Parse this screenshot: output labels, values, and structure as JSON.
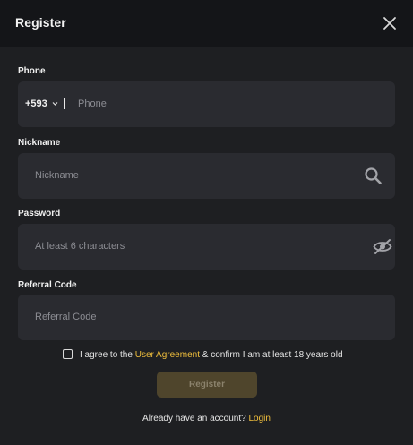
{
  "header": {
    "title": "Register"
  },
  "phone": {
    "label": "Phone",
    "country_code": "+593",
    "placeholder": "Phone"
  },
  "nickname": {
    "label": "Nickname",
    "placeholder": "Nickname"
  },
  "password": {
    "label": "Password",
    "placeholder": "At least 6 characters"
  },
  "referral": {
    "label": "Referral Code",
    "placeholder": "Referral Code"
  },
  "agreement": {
    "prefix": "I agree to the",
    "link": "User Agreement",
    "suffix": "& confirm I am at least 18 years old",
    "checked": false
  },
  "submit": {
    "label": "Register"
  },
  "footer": {
    "prompt": "Already have an account?",
    "link": "Login"
  },
  "colors": {
    "background": "#1e1f22",
    "header": "#141518",
    "field": "#2a2b30",
    "accent": "#f1bf3c",
    "button": "#4f452c"
  },
  "icons": [
    "close-icon",
    "chevron-down-icon",
    "search-icon",
    "eye-off-icon"
  ]
}
